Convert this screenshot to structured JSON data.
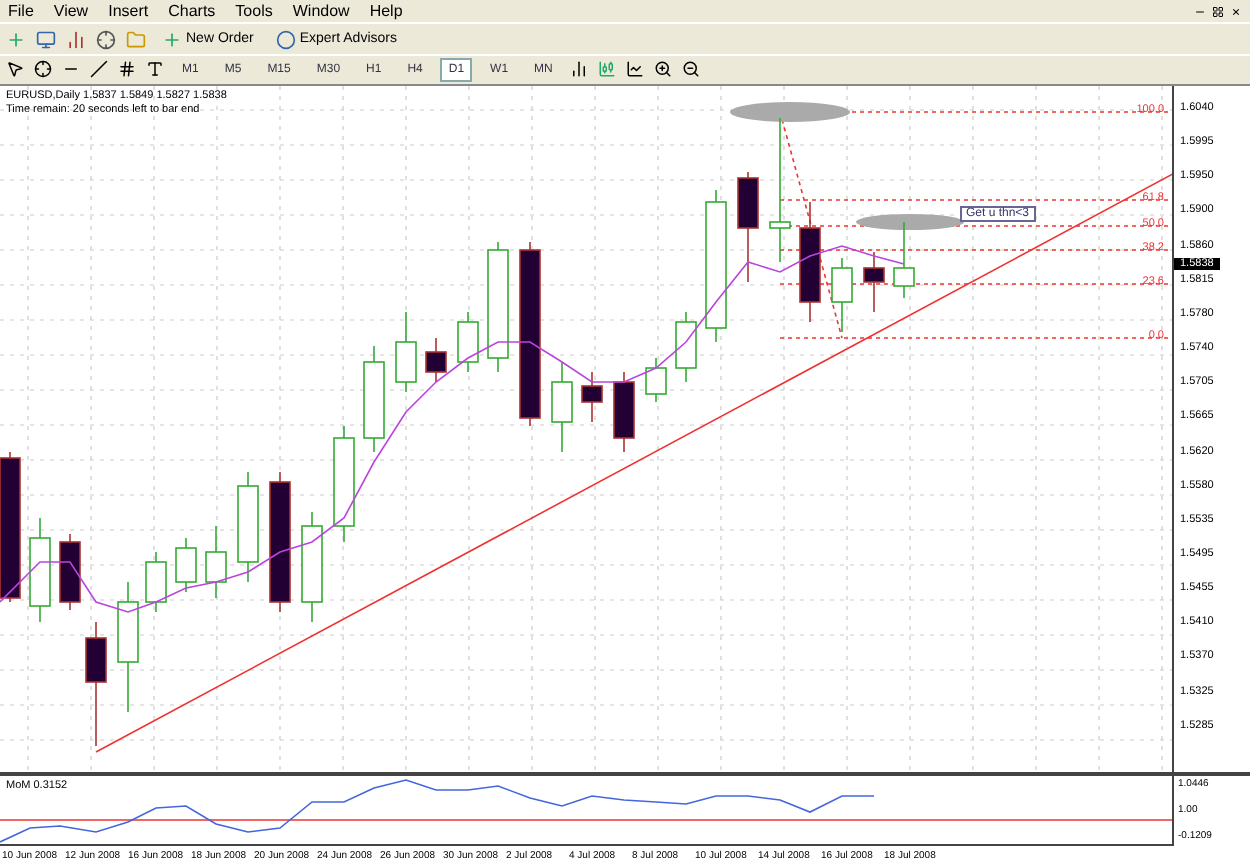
{
  "menu": [
    "File",
    "View",
    "Insert",
    "Charts",
    "Tools",
    "Window",
    "Help"
  ],
  "toolbar": {
    "buttons": [
      "New Order",
      "Expert Advisors"
    ]
  },
  "timeframes": [
    {
      "label": "M1",
      "selected": false
    },
    {
      "label": "M5",
      "selected": false
    },
    {
      "label": "M15",
      "selected": false
    },
    {
      "label": "M30",
      "selected": false
    },
    {
      "label": "H1",
      "selected": false
    },
    {
      "label": "H4",
      "selected": false
    },
    {
      "label": "D1",
      "selected": true
    },
    {
      "label": "W1",
      "selected": false
    },
    {
      "label": "MN",
      "selected": false
    }
  ],
  "chart": {
    "header_lines": [
      "EURUSD,Daily  1.5837 1.5849 1.5827 1.5838",
      "Time remain: 20 seconds left to bar end"
    ],
    "price_labels": [
      "1.6040",
      "1.5995",
      "1.5950",
      "1.5900",
      "1.5860",
      "1.5815",
      "1.5780",
      "1.5740",
      "1.5705",
      "1.5665",
      "1.5620",
      "1.5580",
      "1.5535",
      "1.5495",
      "1.5455",
      "1.5410",
      "1.5370",
      "1.5325",
      "1.5285"
    ],
    "current_price": "1.5838",
    "fib_levels": [
      "100.0",
      "61.8",
      "50.0",
      "38.2",
      "23.6",
      "0.0"
    ],
    "annotation": "Get u thn<3"
  },
  "indicator": {
    "label": "MoM  0.3152",
    "scale": [
      "1.0446",
      "1.00",
      "-0.1209"
    ]
  },
  "dates": [
    "10 Jun 2008",
    "12 Jun 2008",
    "16 Jun 2008",
    "18 Jun 2008",
    "20 Jun 2008",
    "24 Jun 2008",
    "26 Jun 2008",
    "30 Jun 2008",
    "2 Jul 2008",
    "4 Jul 2008",
    "8 Jul 2008",
    "10 Jul 2008",
    "14 Jul 2008",
    "16 Jul 2008",
    "18 Jul 2008"
  ]
}
